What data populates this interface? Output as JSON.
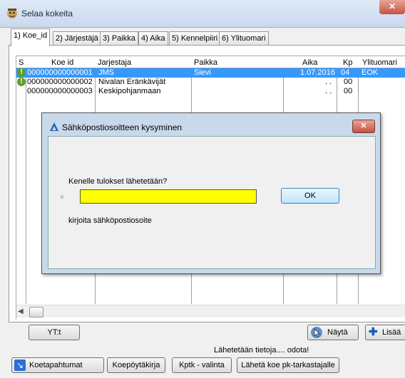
{
  "window": {
    "title": "Selaa kokeita",
    "close_label": "✕"
  },
  "tabs": [
    {
      "label": "1) Koe_id"
    },
    {
      "label": "2) Järjestäjä"
    },
    {
      "label": "3) Paikka"
    },
    {
      "label": "4) Aika"
    },
    {
      "label": "5) Kennelpiiri"
    },
    {
      "label": "6) Ylituomari"
    }
  ],
  "table": {
    "columns": [
      "S",
      "Koe id",
      "Jarjestaja",
      "Paikka",
      "Aika",
      "Kp",
      "Ylituomari"
    ],
    "rows": [
      {
        "koe_id": "000000000000001",
        "jarjestaja": "JMS",
        "paikka": "Sievi",
        "aika": "1.07.2016",
        "kp": "04",
        "ylituomari": "EOK",
        "warn": true,
        "selected": true
      },
      {
        "koe_id": "000000000000002",
        "jarjestaja": "Nivalan Eränkävijät",
        "paikka": "",
        "aika": ". .",
        "kp": "00",
        "ylituomari": "",
        "warn": true,
        "selected": false
      },
      {
        "koe_id": "000000000000003",
        "jarjestaja": "Keskipohjanmaan",
        "paikka": "",
        "aika": ". .",
        "kp": "00",
        "ylituomari": "",
        "warn": false,
        "selected": false
      }
    ]
  },
  "buttons": {
    "yt": "YT:t",
    "nayta": "Näytä",
    "lisaa": "Lisää",
    "koetapahtumat": "Koetapahtumat",
    "koepoytakirja": "Koepöytäkirja",
    "kptk_valinta": "Kptk - valinta",
    "laheta": "Lähetä koe pk-tarkastajalle"
  },
  "status": "Lähetetään tietoja.... odota!",
  "dialog": {
    "title": "Sähköpostiosoitteen kysyminen",
    "close_label": "✕",
    "question": "Kenelle tulokset lähetetään?",
    "input_value": "",
    "input_marker": "»",
    "ok": "OK",
    "hint": "kirjoita sähköpostiosoite"
  },
  "colors": {
    "selection": "#3399ff",
    "input_bg": "#ffff00",
    "warn": "#5a9e2f"
  }
}
